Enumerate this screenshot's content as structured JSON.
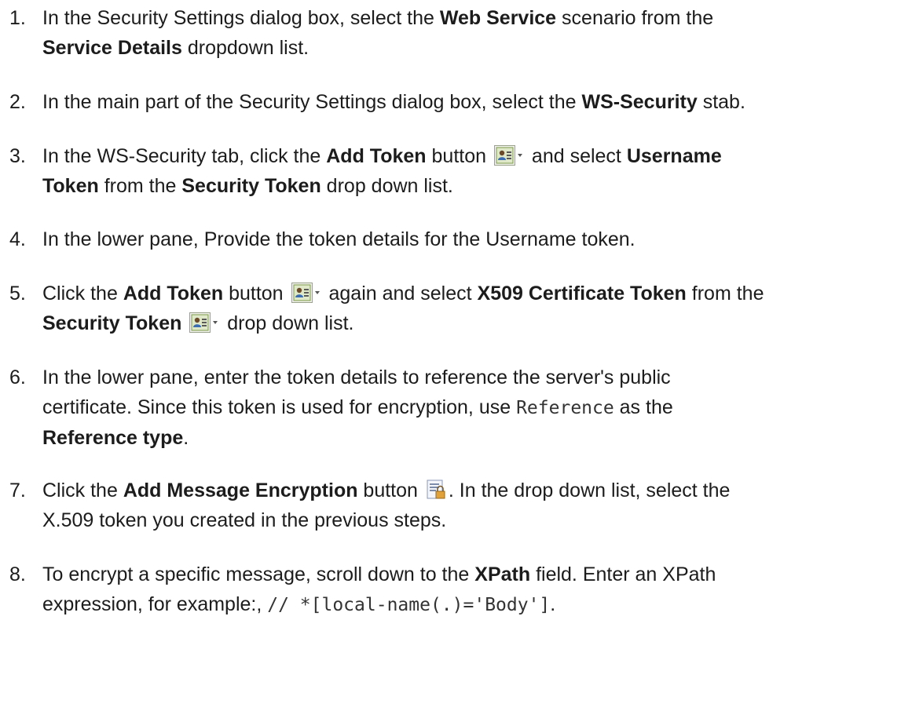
{
  "steps": [
    {
      "number": "1.",
      "t1": "In the Security Settings dialog box, select the ",
      "b1": "Web Service",
      "t2": " scenario from the",
      "b2": "Service Details",
      "t3": " dropdown list."
    },
    {
      "number": "2.",
      "t1": "In the main part of the Security Settings dialog box, select the ",
      "b1": "WS-Security",
      "t2": " stab."
    },
    {
      "number": "3.",
      "t1": "In the WS-Security tab, click the ",
      "b1": "Add Token",
      "t2": " button ",
      "t3": " and select ",
      "b2": "Username",
      "b3": "Token",
      "t4": " from the ",
      "b4": "Security Token",
      "t5": " drop down list."
    },
    {
      "number": "4.",
      "t1": "In the lower pane, Provide the token details for the Username token."
    },
    {
      "number": "5.",
      "t1": "Click the ",
      "b1": "Add Token",
      "t2": " button ",
      "t3": " again and select ",
      "b2": "X509 Certificate Token",
      "t4": " from the",
      "b3": "Security Token",
      "t5": " drop down list."
    },
    {
      "number": "6.",
      "t1": "In the lower pane, enter the token details to reference the server's public",
      "t2": "certificate. Since this token is used for encryption, use ",
      "code1": "Reference",
      "t3": " as the",
      "b1": "Reference type",
      "t4": "."
    },
    {
      "number": "7.",
      "t1": "Click the ",
      "b1": "Add Message Encryption",
      "t2": " button ",
      "t3": ". In the drop down list, select the",
      "t4": "X.509 token you created in the previous steps."
    },
    {
      "number": "8.",
      "t1": "To encrypt a specific message, scroll down to the ",
      "b1": "XPath",
      "t2": " field. Enter an XPath",
      "t3": "expression, for example:, ",
      "code1": "// *[local-name(.)='Body']",
      "t4": "."
    }
  ],
  "icons": {
    "add_token": "add-token-dropdown-icon",
    "add_message_encryption": "add-message-encryption-icon"
  }
}
